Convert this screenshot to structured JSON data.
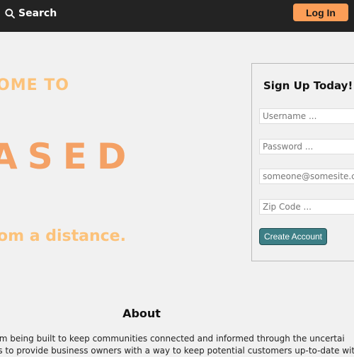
{
  "nav": {
    "search_label": "Search",
    "search_icon": "search-icon",
    "login_label": "Log In",
    "login_color": "#fd9e57",
    "bar_color": "#232323"
  },
  "hero": {
    "welcome": "OME TO",
    "logo_text": "ASED",
    "tagline": "om a distance.",
    "accent_color": "#fcc27a"
  },
  "signup": {
    "title": "Sign Up Today!",
    "username_placeholder": "Username ...",
    "password_placeholder": "Password ...",
    "email_placeholder": "someone@somesite.co",
    "zip_placeholder": "Zip Code ...",
    "create_label": "Create Account",
    "button_color": "#3d7f86"
  },
  "about": {
    "heading": "About",
    "line1": "rm being built to keep communities connected and informed through the uncertai",
    "line2": "is to provide business owners with a way to keep potential customers up-to-date wit"
  }
}
